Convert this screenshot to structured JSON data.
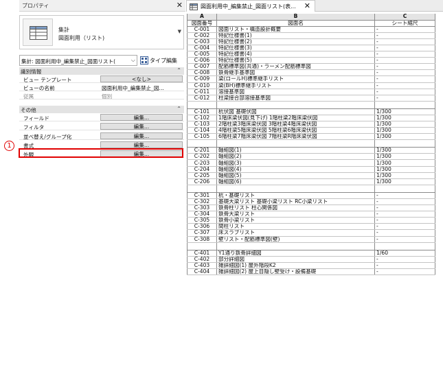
{
  "properties": {
    "title": "プロパティ",
    "type_selector": {
      "line1": "集計",
      "line2": "図面利用（リスト)"
    },
    "instance_filter": "集計: 図面利用中_編集禁止_図面リスト(",
    "edit_type_label": "タイプ編集",
    "groups": {
      "identity": "識別情報",
      "other": "その他"
    },
    "identity_rows": [
      {
        "key": "ビュー テンプレート",
        "value": "<なし>"
      },
      {
        "key": "ビューの名前",
        "value": "図面利用中_編集禁止_図..."
      },
      {
        "key": "従属",
        "value": "個別"
      }
    ],
    "other_rows": [
      {
        "key": "フィールド",
        "value": "編集..."
      },
      {
        "key": "フィルタ",
        "value": "編集..."
      },
      {
        "key": "並べ替え/グループ化",
        "value": "編集..."
      },
      {
        "key": "書式",
        "value": "編集..."
      },
      {
        "key": "外観",
        "value": "編集..."
      }
    ],
    "callout_number": "1",
    "highlight_color": "#e00000"
  },
  "schedule": {
    "tab_title": "図面利用中_編集禁止_図面リスト(表...",
    "columns": {
      "a": "A",
      "b": "B",
      "c": "C"
    },
    "headers": {
      "number": "図面番号",
      "name": "図面名",
      "scale": "シート縮尺"
    },
    "groups": [
      [
        [
          "C-001",
          "図面リスト・構造設計概要",
          "-"
        ],
        [
          "C-002",
          "特記仕様書(1)",
          "-"
        ],
        [
          "C-003",
          "特記仕様書(2)",
          "-"
        ],
        [
          "C-004",
          "特記仕様書(3)",
          "-"
        ],
        [
          "C-005",
          "特記仕様書(4)",
          "-"
        ],
        [
          "C-006",
          "特記仕様書(5)",
          "-"
        ],
        [
          "C-007",
          "配筋標準図(共通)・ラーメン配筋標準図",
          "-"
        ],
        [
          "C-008",
          "鉄骨継手基準図",
          "-"
        ],
        [
          "C-009",
          "梁(ロールH)標準継手リスト",
          "-"
        ],
        [
          "C-010",
          "梁(BH)標準継手リスト",
          "-"
        ],
        [
          "C-011",
          "溶接基準図",
          "-"
        ],
        [
          "C-012",
          "柱梁接合部溶接基準図",
          "-"
        ]
      ],
      [
        [
          "C-101",
          "杭伏図 基礎伏図",
          "1/300"
        ],
        [
          "C-102",
          "1階床梁伏図(見下げ) 1階柱梁2階床梁伏図",
          "1/300"
        ],
        [
          "C-103",
          "2階柱梁3階床梁伏図 3階柱梁4階床梁伏図",
          "1/300"
        ],
        [
          "C-104",
          "4階柱梁5階床梁伏図 5階柱梁6階床梁伏図",
          "1/300"
        ],
        [
          "C-105",
          "6階柱梁7階床梁伏図 7階柱梁R階床梁伏図",
          "1/300"
        ]
      ],
      [
        [
          "C-201",
          "軸組図(1)",
          "1/300"
        ],
        [
          "C-202",
          "軸組図(2)",
          "1/300"
        ],
        [
          "C-203",
          "軸組図(3)",
          "1/300"
        ],
        [
          "C-204",
          "軸組図(4)",
          "1/300"
        ],
        [
          "C-205",
          "軸組図(5)",
          "1/300"
        ],
        [
          "C-206",
          "軸組図(6)",
          "1/300"
        ]
      ],
      [
        [
          "C-301",
          "杭・基礎リスト",
          "-"
        ],
        [
          "C-302",
          "基礎大梁リスト 基礎小梁リスト RC小梁リスト",
          "-"
        ],
        [
          "C-303",
          "鉄骨柱リスト 柱心関係図",
          "-"
        ],
        [
          "C-304",
          "鉄骨大梁リスト",
          "-"
        ],
        [
          "C-305",
          "鉄骨小梁リスト",
          "-"
        ],
        [
          "C-306",
          "間柱リスト",
          "-"
        ],
        [
          "C-307",
          "床スラブリスト",
          "-"
        ],
        [
          "C-308",
          "壁リスト・配筋標準図(壁)",
          "-"
        ]
      ],
      [
        [
          "C-401",
          "Y1通り鉄骨詳細図",
          "1/60"
        ],
        [
          "C-402",
          "部分詳細図",
          "-"
        ],
        [
          "C-403",
          "雑詳細図(1) 屋外階段K2",
          "-"
        ],
        [
          "C-404",
          "雑詳細図(2) 屋上目隠し壁受け・設備基礎",
          "-"
        ]
      ]
    ]
  }
}
